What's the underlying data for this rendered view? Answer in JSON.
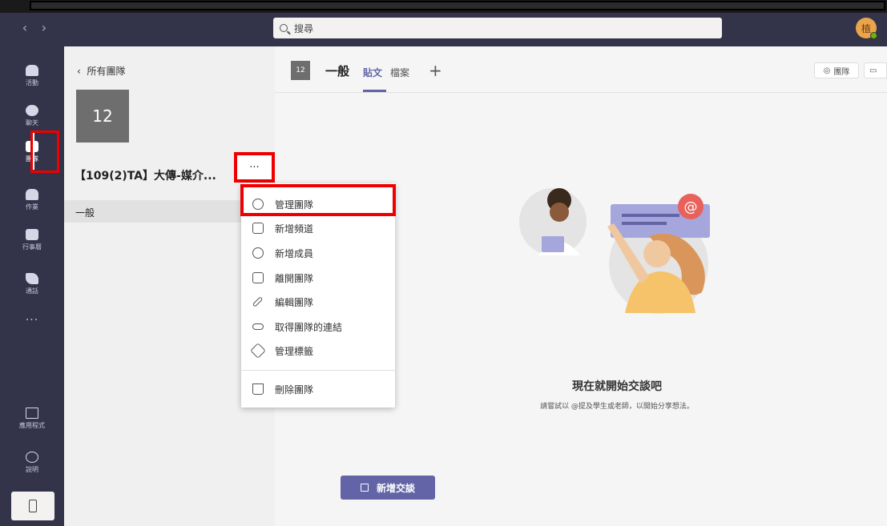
{
  "topbar": {
    "search_placeholder": "搜尋",
    "avatar_initial": "植"
  },
  "rail": {
    "items": [
      {
        "label": "活動"
      },
      {
        "label": "聊天"
      },
      {
        "label": "團隊"
      },
      {
        "label": "作業"
      },
      {
        "label": "行事曆"
      },
      {
        "label": "通話"
      }
    ],
    "more": "···",
    "apps_label": "應用程式",
    "help_label": "說明"
  },
  "teampanel": {
    "back_label": "所有團隊",
    "team_tile": "12",
    "team_name": "【109(2)TA】大傳-媒介...",
    "more_dots": "···",
    "channel": "一般"
  },
  "menu": {
    "items": [
      {
        "label": "管理團隊",
        "icon": "gear-icon"
      },
      {
        "label": "新增頻道",
        "icon": "add-channel-icon"
      },
      {
        "label": "新增成員",
        "icon": "add-member-icon"
      },
      {
        "label": "離開團隊",
        "icon": "leave-icon"
      },
      {
        "label": "編輯團隊",
        "icon": "pencil-icon"
      },
      {
        "label": "取得團隊的連結",
        "icon": "link-icon"
      },
      {
        "label": "管理標籤",
        "icon": "tag-icon"
      },
      {
        "label": "刪除團隊",
        "icon": "trash-icon"
      }
    ]
  },
  "main": {
    "channel_tile": "12",
    "channel_title": "一般",
    "tabs": [
      {
        "label": "貼文"
      },
      {
        "label": "檔案"
      }
    ],
    "add_tab": "+",
    "team_button": "團隊",
    "empty_title": "現在就開始交談吧",
    "empty_subtitle": "請嘗試以 @提及學生或老師，以開始分享想法。",
    "new_conversation": "新增交談"
  },
  "colors": {
    "accent": "#6264a7",
    "rail": "#33344a",
    "highlight": "#ee0000"
  }
}
